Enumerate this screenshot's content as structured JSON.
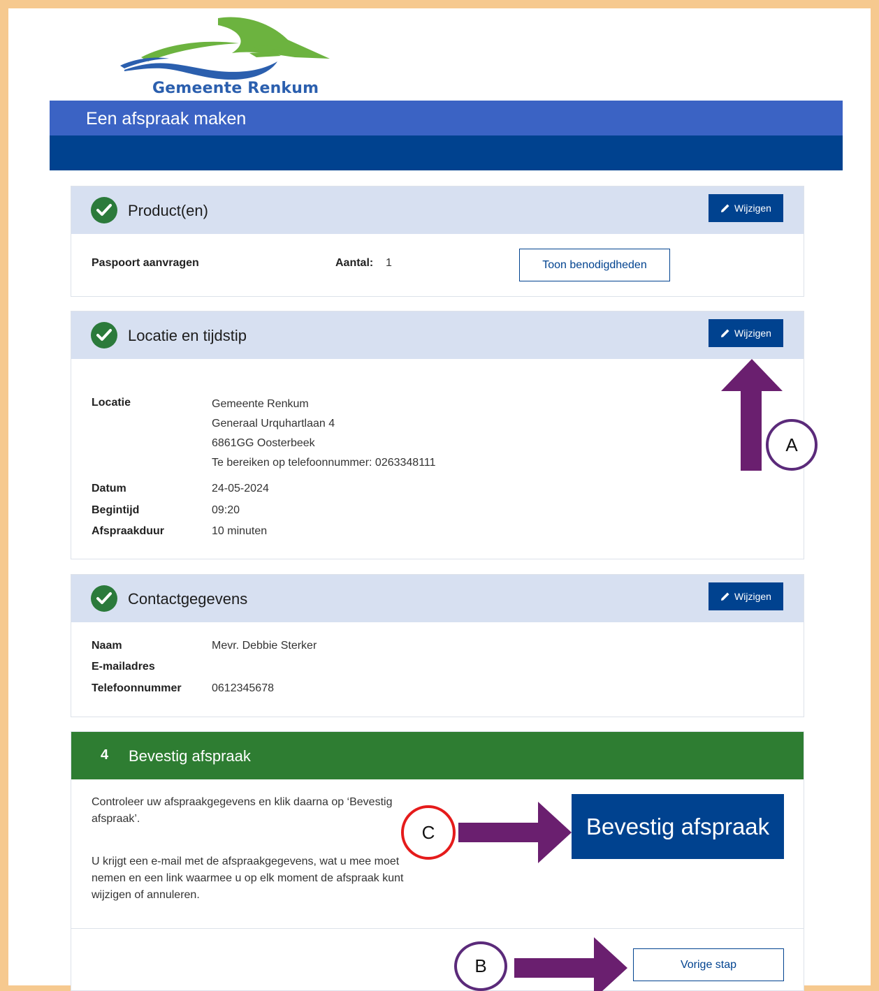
{
  "logo": {
    "text": "Gemeente Renkum"
  },
  "header": {
    "title": "Een afspraak maken"
  },
  "colors": {
    "primary": "#00428f",
    "header_blue": "#3b63c4",
    "success": "#2e7d32",
    "annotation": "#6a1f6f",
    "frame": "#f6c98f"
  },
  "edit_label": "Wijzigen",
  "products": {
    "title": "Product(en)",
    "item": "Paspoort aanvragen",
    "quantity_label": "Aantal:",
    "quantity_value": "1",
    "show_button": "Toon benodigdheden"
  },
  "location": {
    "title": "Locatie en tijdstip",
    "locatie_label": "Locatie",
    "address_lines": [
      "Gemeente Renkum",
      "Generaal Urquhartlaan 4",
      "6861GG Oosterbeek",
      "Te bereiken op telefoonnummer: 0263348111"
    ],
    "date_label": "Datum",
    "date_value": "24-05-2024",
    "start_label": "Begintijd",
    "start_value": "09:20",
    "duration_label": "Afspraakduur",
    "duration_value": "10 minuten"
  },
  "contact": {
    "title": "Contactgegevens",
    "name_label": "Naam",
    "name_value": "Mevr. Debbie Sterker",
    "email_label": "E-mailadres",
    "phone_label": "Telefoonnummer",
    "phone_value": "0612345678"
  },
  "confirm": {
    "step_number": "4",
    "title": "Bevestig afspraak",
    "instruction": "Controleer uw afspraakgegevens en klik daarna op ‘Bevestig afspraak’.",
    "info": "U krijgt een e-mail met de afspraakgegevens, wat u mee moet nemen en een link waarmee u op elk moment de afspraak kunt wijzigen of annuleren.",
    "button": "Bevestig afspraak",
    "previous_button": "Vorige stap"
  },
  "annotations": {
    "a": "A",
    "b": "B",
    "c": "C"
  }
}
